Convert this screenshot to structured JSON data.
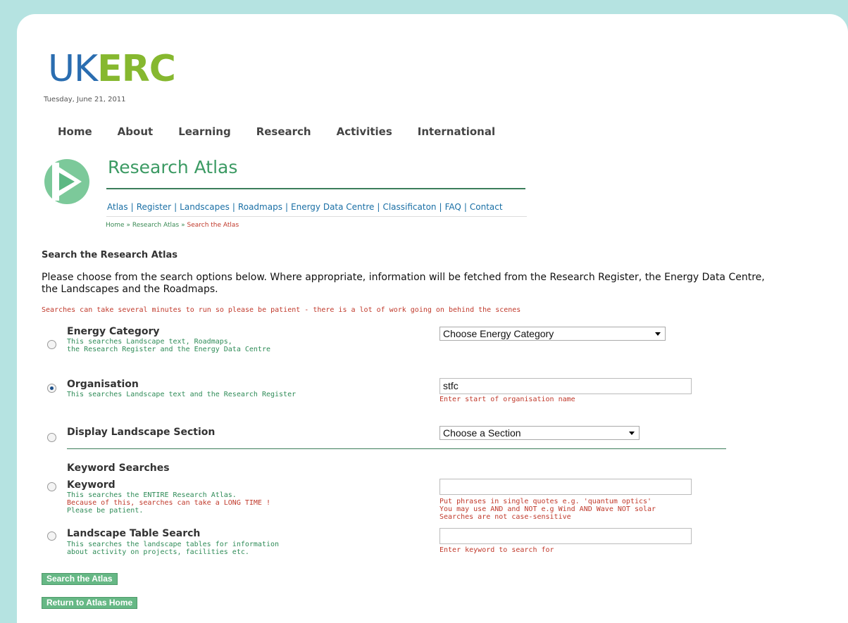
{
  "logo": {
    "uk": "UK",
    "erc": "ERC"
  },
  "date": "Tuesday, June 21, 2011",
  "main_nav": [
    "Home",
    "About",
    "Learning",
    "Research",
    "Activities",
    "International"
  ],
  "atlas": {
    "title": "Research Atlas",
    "subnav": [
      "Atlas",
      "Register",
      "Landscapes",
      "Roadmaps",
      "Energy Data Centre",
      "Classificaton",
      "FAQ",
      "Contact"
    ],
    "breadcrumb": {
      "home": "Home",
      "sep1": "»",
      "atlas": "Research Atlas",
      "sep2": "»",
      "current": "Search the Atlas"
    }
  },
  "search": {
    "heading": "Search the Research Atlas",
    "intro": "Please choose from the search options below.  Where appropriate, information will be fetched from the Research Register, the Energy Data Centre, the Landscapes and the Roadmaps.",
    "warning": "Searches can take several minutes to run so please be patient - there is a lot of work going on behind the scenes",
    "energy": {
      "label": "Energy Category",
      "desc1": "This searches Landscape text, Roadmaps,",
      "desc2": "the Research Register and the Energy Data Centre",
      "select": "Choose Energy Category"
    },
    "organisation": {
      "label": "Organisation",
      "desc": "This searches Landscape text and the Research Register",
      "value": "stfc",
      "hint": "Enter start of organisation name"
    },
    "landscape_section": {
      "label": "Display Landscape Section",
      "select": "Choose a Section"
    },
    "keyword_heading": "Keyword Searches",
    "keyword": {
      "label": "Keyword",
      "desc1": "This searches the ENTIRE Research Atlas.",
      "desc2": "Because of this, searches can take a LONG TIME !",
      "desc3": "Please be patient.",
      "value": "",
      "hint1": "Put phrases in single quotes e.g. 'quantum optics'",
      "hint2": "You may use AND and NOT e.g Wind AND Wave NOT solar",
      "hint3": "Searches are not case-sensitive"
    },
    "table_search": {
      "label": "Landscape Table Search",
      "desc1": "This searches the landscape tables for information",
      "desc2": "about activity on projects, facilities etc.",
      "value": "",
      "hint": "Enter keyword to search for"
    },
    "search_button": "Search the Atlas",
    "return_button": "Return to Atlas Home"
  },
  "colors": {
    "background": "#b5e3e1",
    "brand_blue": "#2a6db0",
    "brand_green": "#86b82f",
    "atlas_green": "#3b9a63",
    "warning_red": "#c0392b",
    "button_green": "#66b885"
  }
}
